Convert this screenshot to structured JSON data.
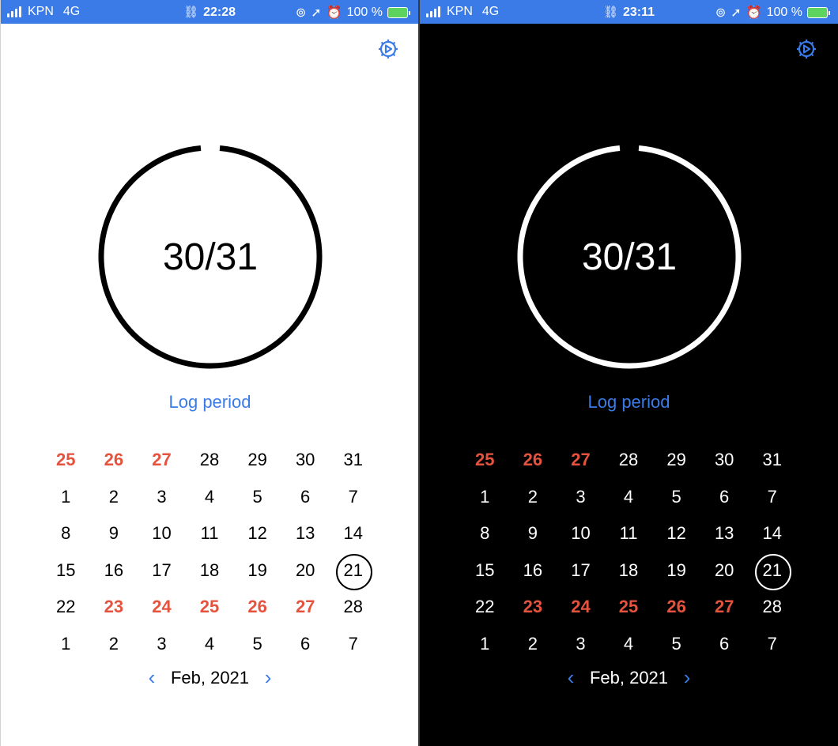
{
  "accent_color": "#3b7be8",
  "period_color": "#e5533e",
  "screens": [
    {
      "theme": "light",
      "status": {
        "carrier": "KPN",
        "network": "4G",
        "time": "22:28",
        "battery": "100 %"
      },
      "progress": {
        "label": "30/31",
        "value": 30,
        "total": 31
      },
      "log_label": "Log period",
      "month_label": "Feb, 2021",
      "weeks": [
        [
          {
            "d": "25",
            "p": true
          },
          {
            "d": "26",
            "p": true
          },
          {
            "d": "27",
            "p": true
          },
          {
            "d": "28"
          },
          {
            "d": "29"
          },
          {
            "d": "30"
          },
          {
            "d": "31"
          }
        ],
        [
          {
            "d": "1"
          },
          {
            "d": "2"
          },
          {
            "d": "3"
          },
          {
            "d": "4"
          },
          {
            "d": "5"
          },
          {
            "d": "6"
          },
          {
            "d": "7"
          }
        ],
        [
          {
            "d": "8"
          },
          {
            "d": "9"
          },
          {
            "d": "10"
          },
          {
            "d": "11"
          },
          {
            "d": "12"
          },
          {
            "d": "13"
          },
          {
            "d": "14"
          }
        ],
        [
          {
            "d": "15"
          },
          {
            "d": "16"
          },
          {
            "d": "17"
          },
          {
            "d": "18"
          },
          {
            "d": "19"
          },
          {
            "d": "20"
          },
          {
            "d": "21",
            "t": true
          }
        ],
        [
          {
            "d": "22"
          },
          {
            "d": "23",
            "p": true
          },
          {
            "d": "24",
            "p": true
          },
          {
            "d": "25",
            "p": true
          },
          {
            "d": "26",
            "p": true
          },
          {
            "d": "27",
            "p": true
          },
          {
            "d": "28"
          }
        ],
        [
          {
            "d": "1"
          },
          {
            "d": "2"
          },
          {
            "d": "3"
          },
          {
            "d": "4"
          },
          {
            "d": "5"
          },
          {
            "d": "6"
          },
          {
            "d": "7"
          }
        ]
      ]
    },
    {
      "theme": "dark",
      "status": {
        "carrier": "KPN",
        "network": "4G",
        "time": "23:11",
        "battery": "100 %"
      },
      "progress": {
        "label": "30/31",
        "value": 30,
        "total": 31
      },
      "log_label": "Log period",
      "month_label": "Feb, 2021",
      "weeks": [
        [
          {
            "d": "25",
            "p": true
          },
          {
            "d": "26",
            "p": true
          },
          {
            "d": "27",
            "p": true
          },
          {
            "d": "28"
          },
          {
            "d": "29"
          },
          {
            "d": "30"
          },
          {
            "d": "31"
          }
        ],
        [
          {
            "d": "1"
          },
          {
            "d": "2"
          },
          {
            "d": "3"
          },
          {
            "d": "4"
          },
          {
            "d": "5"
          },
          {
            "d": "6"
          },
          {
            "d": "7"
          }
        ],
        [
          {
            "d": "8"
          },
          {
            "d": "9"
          },
          {
            "d": "10"
          },
          {
            "d": "11"
          },
          {
            "d": "12"
          },
          {
            "d": "13"
          },
          {
            "d": "14"
          }
        ],
        [
          {
            "d": "15"
          },
          {
            "d": "16"
          },
          {
            "d": "17"
          },
          {
            "d": "18"
          },
          {
            "d": "19"
          },
          {
            "d": "20"
          },
          {
            "d": "21",
            "t": true
          }
        ],
        [
          {
            "d": "22"
          },
          {
            "d": "23",
            "p": true
          },
          {
            "d": "24",
            "p": true
          },
          {
            "d": "25",
            "p": true
          },
          {
            "d": "26",
            "p": true
          },
          {
            "d": "27",
            "p": true
          },
          {
            "d": "28"
          }
        ],
        [
          {
            "d": "1"
          },
          {
            "d": "2"
          },
          {
            "d": "3"
          },
          {
            "d": "4"
          },
          {
            "d": "5"
          },
          {
            "d": "6"
          },
          {
            "d": "7"
          }
        ]
      ]
    }
  ]
}
